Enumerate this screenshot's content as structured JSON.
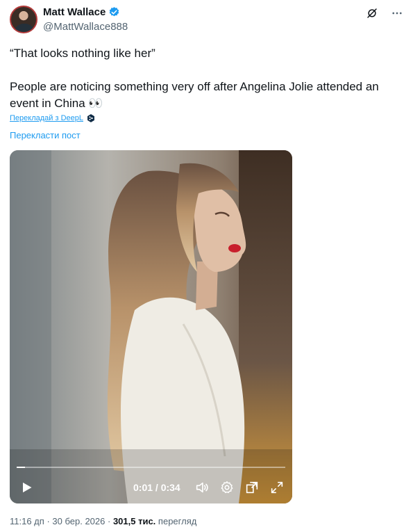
{
  "author": {
    "name": "Matt Wallace",
    "handle": "@MattWallace888"
  },
  "post": {
    "line1": "“That looks nothing like her”",
    "line2": "People are noticing something very off after Angelina Jolie attended an event in China 👀"
  },
  "deepl_link": "Перекладай з DeepL",
  "translate_link": "Перекласти пост",
  "video": {
    "time": "0:01 / 0:34",
    "progress": 0.03
  },
  "meta": {
    "time": "11:16 дп",
    "date": "30 бер. 2026",
    "views_count": "301,5 тис.",
    "views_label": "перегляд"
  },
  "colors": {
    "accent": "#1d9bf0",
    "secondary_text": "#536471"
  },
  "icons": [
    "verified-badge-icon",
    "grok-icon",
    "more-icon",
    "deepl-icon",
    "play-icon",
    "volume-icon",
    "settings-icon",
    "pip-icon",
    "fullscreen-icon"
  ]
}
